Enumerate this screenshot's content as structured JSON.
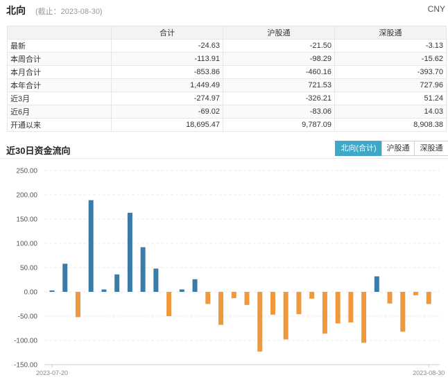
{
  "header": {
    "title": "北向",
    "subtitle": "(截止：2023-08-30)",
    "currency": "CNY"
  },
  "summary_table": {
    "columns": [
      "合计",
      "沪股通",
      "深股通"
    ],
    "rows": [
      {
        "label": "最新",
        "values": [
          "-24.63",
          "-21.50",
          "-3.13"
        ]
      },
      {
        "label": "本周合计",
        "values": [
          "-113.91",
          "-98.29",
          "-15.62"
        ]
      },
      {
        "label": "本月合计",
        "values": [
          "-853.86",
          "-460.16",
          "-393.70"
        ]
      },
      {
        "label": "本年合计",
        "values": [
          "1,449.49",
          "721.53",
          "727.96"
        ]
      },
      {
        "label": "近3月",
        "values": [
          "-274.97",
          "-326.21",
          "51.24"
        ]
      },
      {
        "label": "近6月",
        "values": [
          "-69.02",
          "-83.06",
          "14.03"
        ]
      },
      {
        "label": "开通以来",
        "values": [
          "18,695.47",
          "9,787.09",
          "8,908.38"
        ]
      }
    ]
  },
  "section": {
    "title": "近30日资金流向",
    "tabs": [
      {
        "label": "北向(合计)",
        "active": true
      },
      {
        "label": "沪股通",
        "active": false
      },
      {
        "label": "深股通",
        "active": false
      }
    ]
  },
  "colors": {
    "positive": "#3a7ca8",
    "negative": "#f0993c",
    "tab_active": "#3fa7c7"
  },
  "chart_data": {
    "type": "bar",
    "ylim": [
      -150,
      250
    ],
    "y_ticks": [
      "250.00",
      "200.00",
      "150.00",
      "100.00",
      "50.00",
      "0.00",
      "-50.00",
      "-100.00",
      "-150.00"
    ],
    "x_labels": [
      "2023-07-20",
      "2023-08-30"
    ],
    "grid": true,
    "values": [
      3,
      58,
      -52,
      189,
      5,
      36,
      163,
      92,
      48,
      -50,
      5,
      26,
      -25,
      -68,
      -13,
      -27,
      -123,
      -47,
      -98,
      -46,
      -14,
      -86,
      -65,
      -63,
      -105,
      32,
      -24,
      -82,
      -7,
      -25
    ]
  }
}
